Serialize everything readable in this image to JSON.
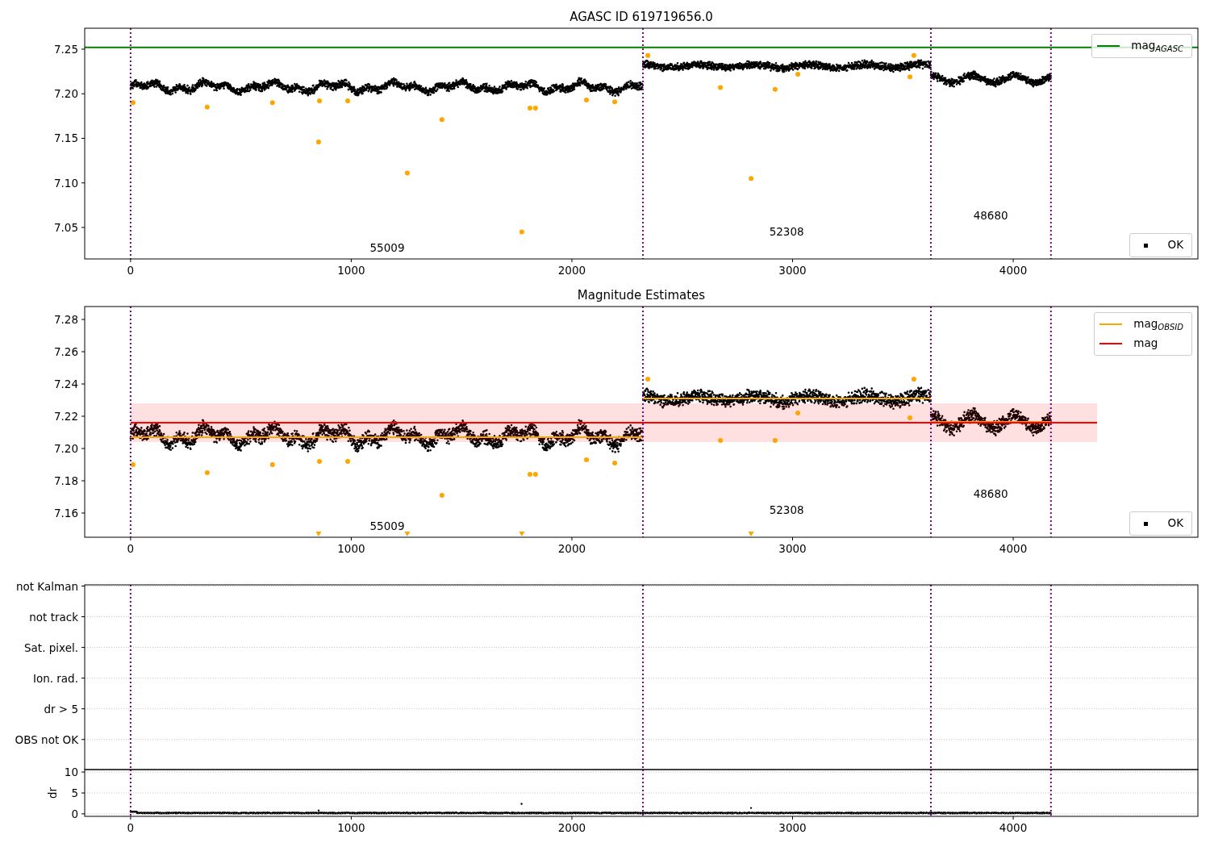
{
  "figure": {
    "panels": [
      {
        "kind": "magnitude",
        "title": "AGASC ID 619719656.0",
        "chart_data": {
          "type": "scatter",
          "xlim": [
            -208,
            4837
          ],
          "ylim": [
            7.0147,
            7.2735
          ],
          "xticks": [
            {
              "value": 0,
              "label": "0"
            },
            {
              "value": 1000,
              "label": "1000"
            },
            {
              "value": 2000,
              "label": "2000"
            },
            {
              "value": 3000,
              "label": "3000"
            },
            {
              "value": 4000,
              "label": "4000"
            }
          ],
          "yticks": [
            {
              "value": 7.05,
              "label": "7.05"
            },
            {
              "value": 7.1,
              "label": "7.10"
            },
            {
              "value": 7.15,
              "label": "7.15"
            },
            {
              "value": 7.2,
              "label": "7.20"
            },
            {
              "value": 7.25,
              "label": "7.25"
            }
          ],
          "ref_lines": [
            {
              "axis": "x",
              "value": 0,
              "color": "#800080"
            },
            {
              "axis": "x",
              "value": 2322,
              "color": "#800080"
            },
            {
              "axis": "x",
              "value": 3627,
              "color": "#800080"
            },
            {
              "axis": "x",
              "value": 4171,
              "color": "#800080"
            }
          ],
          "series": [
            {
              "type": "scatter",
              "color": "#ffa500",
              "x": [
                11,
                347,
                643,
                852,
                856,
                984,
                1254,
                1411,
                1773,
                1810,
                1835,
                2066,
                2194,
                2344,
                2673,
                2812,
                2921,
                3024,
                3532,
                3550
              ],
              "values": [
                7.19,
                7.185,
                7.19,
                7.146,
                7.192,
                7.192,
                7.111,
                7.171,
                7.045,
                7.184,
                7.184,
                7.193,
                7.191,
                7.243,
                7.207,
                7.105,
                7.205,
                7.222,
                7.219,
                7.243
              ]
            },
            {
              "type": "line",
              "color": "#008000",
              "x": [
                -208,
                4837
              ],
              "values": [
                7.252,
                7.252
              ]
            }
          ],
          "annotations": [
            "55009",
            "52308",
            "48680"
          ]
        },
        "legends": [
          {
            "entries": [
              {
                "label": "mag$_{AGASC}$",
                "kind": "line",
                "color": "#008000"
              }
            ]
          },
          {
            "entries": [
              {
                "label": "OK",
                "kind": "point",
                "color": "#000000"
              }
            ]
          }
        ]
      },
      {
        "kind": "magnitude",
        "title": "Magnitude Estimates",
        "chart_data": {
          "type": "scatter",
          "xlim": [
            -208,
            4837
          ],
          "ylim": [
            7.145,
            7.288
          ],
          "xticks": [
            {
              "value": 0,
              "label": "0"
            },
            {
              "value": 1000,
              "label": "1000"
            },
            {
              "value": 2000,
              "label": "2000"
            },
            {
              "value": 3000,
              "label": "3000"
            },
            {
              "value": 4000,
              "label": "4000"
            }
          ],
          "yticks": [
            {
              "value": 7.16,
              "label": "7.16"
            },
            {
              "value": 7.18,
              "label": "7.18"
            },
            {
              "value": 7.2,
              "label": "7.20"
            },
            {
              "value": 7.22,
              "label": "7.22"
            },
            {
              "value": 7.24,
              "label": "7.24"
            },
            {
              "value": 7.26,
              "label": "7.26"
            },
            {
              "value": 7.28,
              "label": "7.28"
            }
          ],
          "ref_lines": [
            {
              "axis": "x",
              "value": 0,
              "color": "#800080"
            },
            {
              "axis": "x",
              "value": 2322,
              "color": "#800080"
            },
            {
              "axis": "x",
              "value": 3627,
              "color": "#800080"
            },
            {
              "axis": "x",
              "value": 4171,
              "color": "#800080"
            }
          ],
          "bands": [
            {
              "axis": "y",
              "from": 7.204,
              "to": 7.228,
              "color": "#ff0000"
            }
          ],
          "series": [
            {
              "type": "scatter",
              "color": "#ffa500",
              "x": [
                11,
                347,
                643,
                852,
                856,
                984,
                1254,
                1411,
                1773,
                1810,
                1835,
                2066,
                2194,
                2344,
                2673,
                2812,
                2921,
                3024,
                3532,
                3550
              ],
              "values": [
                7.19,
                7.185,
                7.19,
                null,
                7.192,
                7.192,
                null,
                7.171,
                null,
                7.184,
                7.184,
                7.193,
                7.191,
                7.243,
                7.205,
                null,
                7.205,
                7.222,
                7.219,
                7.243
              ]
            },
            {
              "type": "line",
              "color": "#ffa500",
              "x": [
                0,
                2320,
                2321,
                2322,
                3625,
                3626,
                3627,
                4170
              ],
              "values": [
                7.207,
                7.207,
                null,
                7.231,
                7.231,
                null,
                7.2165,
                7.2165
              ]
            },
            {
              "type": "line",
              "color": "#ff0000",
              "x": [
                0,
                4380
              ],
              "values": [
                7.216,
                7.216
              ]
            }
          ],
          "annotations": [
            "55009",
            "52308",
            "48680"
          ]
        },
        "legends": [
          {
            "entries": [
              {
                "label": "mag$_{OBSID}$",
                "kind": "line",
                "color": "#ffa500"
              },
              {
                "label": "mag",
                "kind": "line",
                "color": "#ff0000"
              }
            ]
          },
          {
            "entries": [
              {
                "label": "OK",
                "kind": "point",
                "color": "#000000"
              }
            ]
          }
        ]
      },
      {
        "kind": "flags",
        "chart_data": {
          "type": "scatter",
          "orientation": "horizontal",
          "xlim": [
            -208,
            4837
          ],
          "grid": true,
          "categories": [
            "not Kalman",
            "not track",
            "Sat. pixel.",
            "Ion. rad.",
            "dr > 5",
            "OBS not OK"
          ],
          "ref_lines": [
            {
              "axis": "x",
              "value": 0,
              "color": "#800080"
            },
            {
              "axis": "x",
              "value": 2322,
              "color": "#800080"
            },
            {
              "axis": "x",
              "value": 3627,
              "color": "#800080"
            },
            {
              "axis": "x",
              "value": 4171,
              "color": "#800080"
            }
          ]
        },
        "dr_panel": {
          "chart_data": {
            "type": "scatter",
            "ylabel": "dr",
            "xlim": [
              -208,
              4837
            ],
            "ylim": [
              -0.6,
              10.6
            ],
            "grid": true,
            "xticks": [
              {
                "value": 0,
                "label": "0"
              },
              {
                "value": 1000,
                "label": "1000"
              },
              {
                "value": 2000,
                "label": "2000"
              },
              {
                "value": 3000,
                "label": "3000"
              },
              {
                "value": 4000,
                "label": "4000"
              }
            ],
            "yticks": [
              {
                "value": 0,
                "label": "0"
              },
              {
                "value": 5,
                "label": "5"
              },
              {
                "value": 10,
                "label": "10"
              }
            ],
            "ref_lines": [
              {
                "axis": "x",
                "value": 0,
                "color": "#800080"
              },
              {
                "axis": "x",
                "value": 2322,
                "color": "#800080"
              },
              {
                "axis": "x",
                "value": 3627,
                "color": "#800080"
              },
              {
                "axis": "x",
                "value": 4171,
                "color": "#800080"
              }
            ]
          }
        }
      }
    ]
  }
}
